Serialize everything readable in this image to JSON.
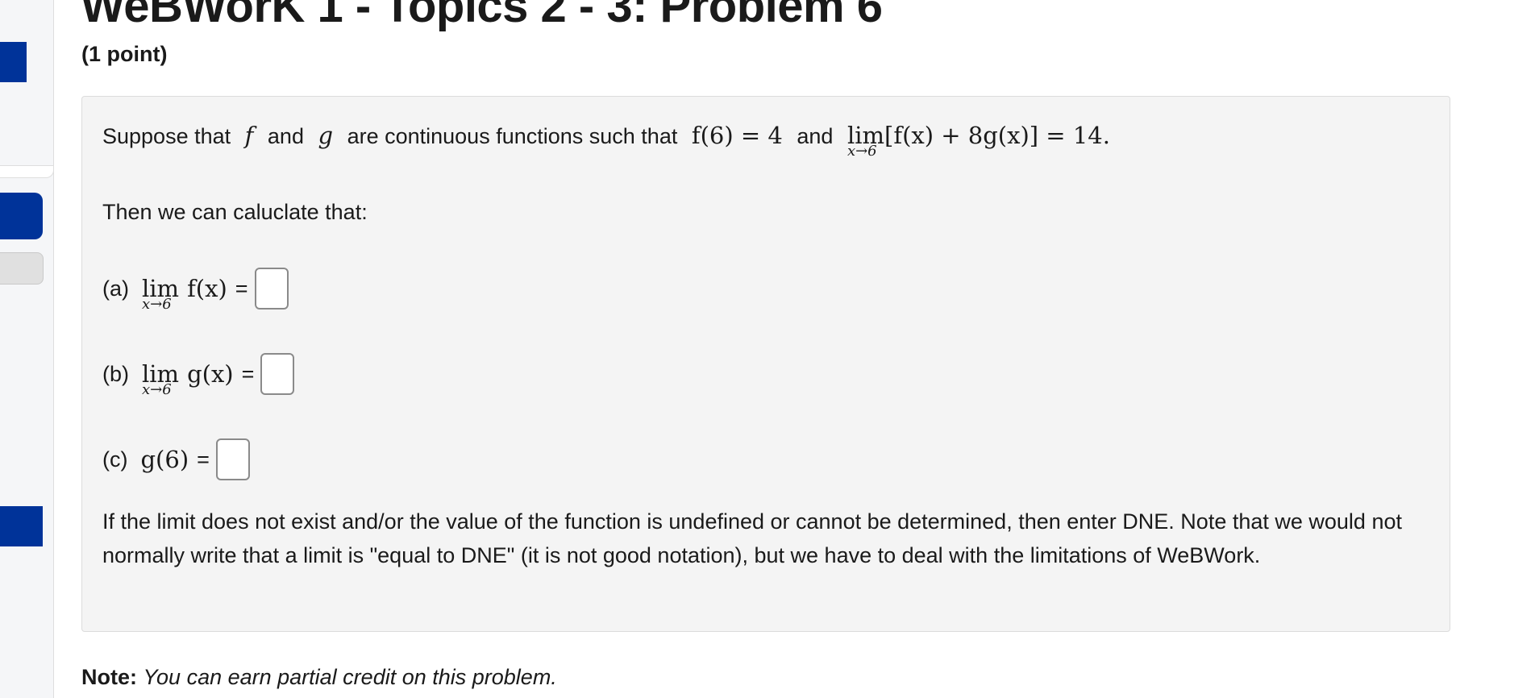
{
  "header": {
    "title": "WeBWorK 1 - Topics 2 - 3: Problem 6",
    "points": "(1 point)"
  },
  "problem": {
    "intro": {
      "t1": "Suppose that",
      "f": "f",
      "t2": "and",
      "g": "g",
      "t3": "are continuous functions such that",
      "cond1": "f(6) = 4",
      "t4": "and",
      "lim_word": "lim",
      "lim_sub": "x→6",
      "cond2_expr": "[f(x) + 8g(x)] = 14."
    },
    "then": "Then we can caluclate that:",
    "parts": [
      {
        "label": "(a)",
        "lim_word": "lim",
        "lim_sub": "x→6",
        "expr": "f(x)",
        "eq": "="
      },
      {
        "label": "(b)",
        "lim_word": "lim",
        "lim_sub": "x→6",
        "expr": "g(x)",
        "eq": "="
      },
      {
        "label": "(c)",
        "expr": "g(6)",
        "eq": "="
      }
    ],
    "note_para": "If the limit does not exist and/or the value of the function is undefined or cannot be determined, then enter DNE. Note that we would not normally write that a limit is \"equal to DNE\" (it is not good notation), but we have to deal with the limitations of WeBWork."
  },
  "footer_note": {
    "label": "Note:",
    "text": "You can earn partial credit on this problem."
  },
  "colors": {
    "accent": "#003399",
    "box_bg": "#f4f4f4"
  }
}
